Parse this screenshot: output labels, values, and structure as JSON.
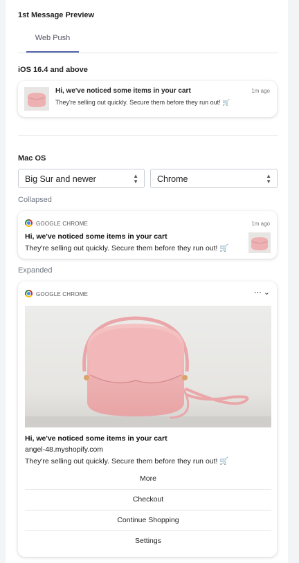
{
  "preview": {
    "title": "1st Message Preview",
    "tab": "Web Push"
  },
  "ios": {
    "heading": "iOS 16.4 and above",
    "notification_title": "Hi, we've noticed some items in your cart",
    "time": "1m ago",
    "body": "They're selling out quickly. Secure them before they run out! 🛒"
  },
  "mac": {
    "heading": "Mac OS",
    "os_select": "Big Sur and newer",
    "browser_select": "Chrome",
    "collapsed_label": "Collapsed",
    "expanded_label": "Expanded",
    "chrome_name": "GOOGLE CHROME",
    "time": "1m ago",
    "notification_title": "Hi, we've noticed some items in your cart",
    "body": "They're selling out quickly. Secure them before they run out! 🛒",
    "site": "angel-48.myshopify.com",
    "more_menu": "⋯ ⌄",
    "actions": [
      "More",
      "Checkout",
      "Continue Shopping",
      "Settings"
    ]
  },
  "colors": {
    "tab_underline": "#5566a8",
    "bag": "#f0b4b4",
    "background": "#f3f4f6"
  }
}
